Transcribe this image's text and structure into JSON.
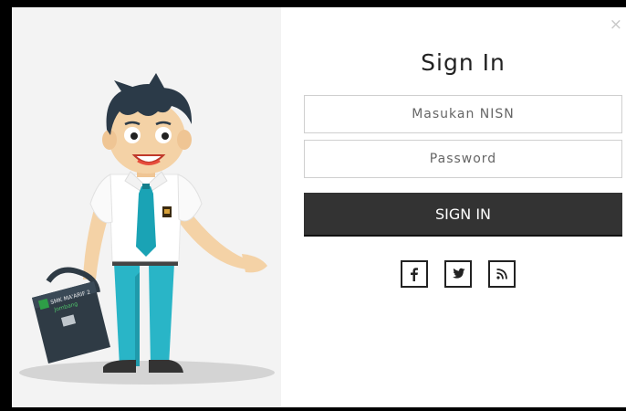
{
  "dialog": {
    "title": "Sign In",
    "close_glyph": "×",
    "fields": {
      "nisn_placeholder": "Masukan NISN",
      "password_placeholder": "Password"
    },
    "submit_label": "SIGN IN",
    "social_icons": [
      "facebook-icon",
      "twitter-icon",
      "rss-icon"
    ]
  },
  "illustration": {
    "badge_line1": "SMK MA'ARIF 2",
    "badge_line2": "Jombang"
  },
  "colors": {
    "button": "#333333",
    "panel": "#f3f3f3",
    "tie": "#1aa3b5",
    "pants": "#29b5c7",
    "bag": "#2f3b45"
  }
}
